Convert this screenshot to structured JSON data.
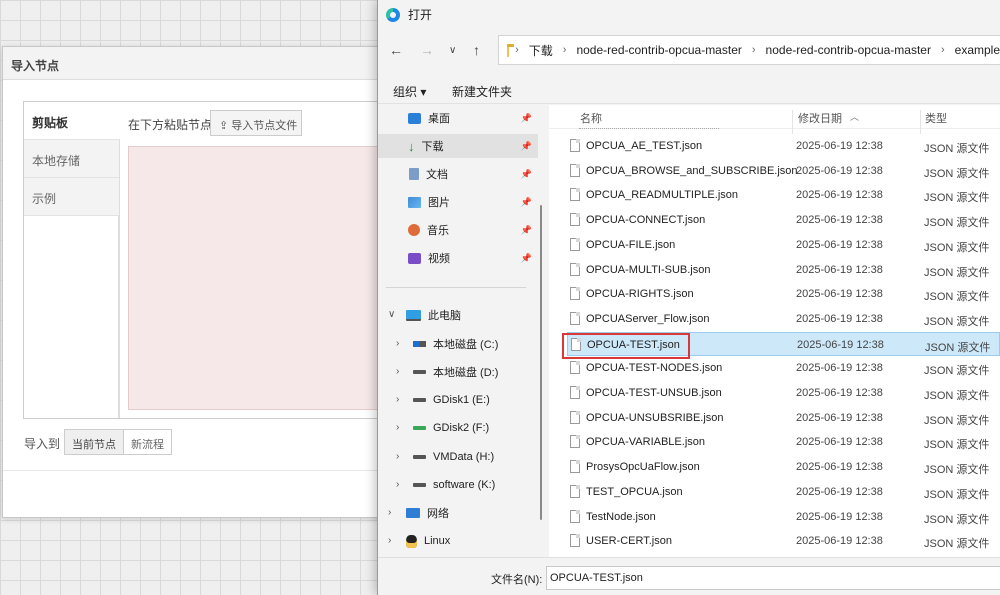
{
  "import_dialog": {
    "title": "导入节点",
    "tabs": [
      {
        "label": "剪贴板"
      },
      {
        "label": "本地存储"
      },
      {
        "label": "示例"
      }
    ],
    "paste_label": "在下方粘贴节点",
    "import_file_button": "导入节点文件",
    "import_to_label": "导入到",
    "targets": [
      {
        "label": "当前节点",
        "selected": true
      },
      {
        "label": "新流程",
        "selected": false
      }
    ]
  },
  "file_dialog": {
    "title": "打开",
    "breadcrumb": [
      "下载",
      "node-red-contrib-opcua-master",
      "node-red-contrib-opcua-master",
      "example"
    ],
    "toolbar": {
      "organize": "组织 ▾",
      "new_folder": "新建文件夹"
    },
    "quick_access": [
      {
        "label": "桌面",
        "icon": "desktop-icon"
      },
      {
        "label": "下载",
        "icon": "downloads-icon"
      },
      {
        "label": "文档",
        "icon": "documents-icon"
      },
      {
        "label": "图片",
        "icon": "pictures-icon"
      },
      {
        "label": "音乐",
        "icon": "music-icon"
      },
      {
        "label": "视频",
        "icon": "videos-icon"
      }
    ],
    "this_pc": "此电脑",
    "drives": [
      {
        "label": "本地磁盘 (C:)"
      },
      {
        "label": "本地磁盘 (D:)"
      },
      {
        "label": "GDisk1 (E:)"
      },
      {
        "label": "GDisk2 (F:)"
      },
      {
        "label": "VMData (H:)"
      },
      {
        "label": "software (K:)"
      }
    ],
    "network": "网络",
    "linux": "Linux",
    "columns": {
      "name": "名称",
      "date": "修改日期",
      "type": "类型"
    },
    "files": [
      {
        "name": "OPCUA_AE_TEST.json",
        "date": "2025-06-19 12:38",
        "type": "JSON 源文件"
      },
      {
        "name": "OPCUA_BROWSE_and_SUBSCRIBE.json",
        "date": "2025-06-19 12:38",
        "type": "JSON 源文件"
      },
      {
        "name": "OPCUA_READMULTIPLE.json",
        "date": "2025-06-19 12:38",
        "type": "JSON 源文件"
      },
      {
        "name": "OPCUA-CONNECT.json",
        "date": "2025-06-19 12:38",
        "type": "JSON 源文件"
      },
      {
        "name": "OPCUA-FILE.json",
        "date": "2025-06-19 12:38",
        "type": "JSON 源文件"
      },
      {
        "name": "OPCUA-MULTI-SUB.json",
        "date": "2025-06-19 12:38",
        "type": "JSON 源文件"
      },
      {
        "name": "OPCUA-RIGHTS.json",
        "date": "2025-06-19 12:38",
        "type": "JSON 源文件"
      },
      {
        "name": "OPCUAServer_Flow.json",
        "date": "2025-06-19 12:38",
        "type": "JSON 源文件"
      },
      {
        "name": "OPCUA-TEST.json",
        "date": "2025-06-19 12:38",
        "type": "JSON 源文件",
        "selected": true
      },
      {
        "name": "OPCUA-TEST-NODES.json",
        "date": "2025-06-19 12:38",
        "type": "JSON 源文件"
      },
      {
        "name": "OPCUA-TEST-UNSUB.json",
        "date": "2025-06-19 12:38",
        "type": "JSON 源文件"
      },
      {
        "name": "OPCUA-UNSUBSRIBE.json",
        "date": "2025-06-19 12:38",
        "type": "JSON 源文件"
      },
      {
        "name": "OPCUA-VARIABLE.json",
        "date": "2025-06-19 12:38",
        "type": "JSON 源文件"
      },
      {
        "name": "ProsysOpcUaFlow.json",
        "date": "2025-06-19 12:38",
        "type": "JSON 源文件"
      },
      {
        "name": "TEST_OPCUA.json",
        "date": "2025-06-19 12:38",
        "type": "JSON 源文件"
      },
      {
        "name": "TestNode.json",
        "date": "2025-06-19 12:38",
        "type": "JSON 源文件"
      },
      {
        "name": "USER-CERT.json",
        "date": "2025-06-19 12:38",
        "type": "JSON 源文件"
      }
    ],
    "filename_label": "文件名(N):",
    "filename_value": "OPCUA-TEST.json",
    "highlight_color": "#d9383a"
  }
}
